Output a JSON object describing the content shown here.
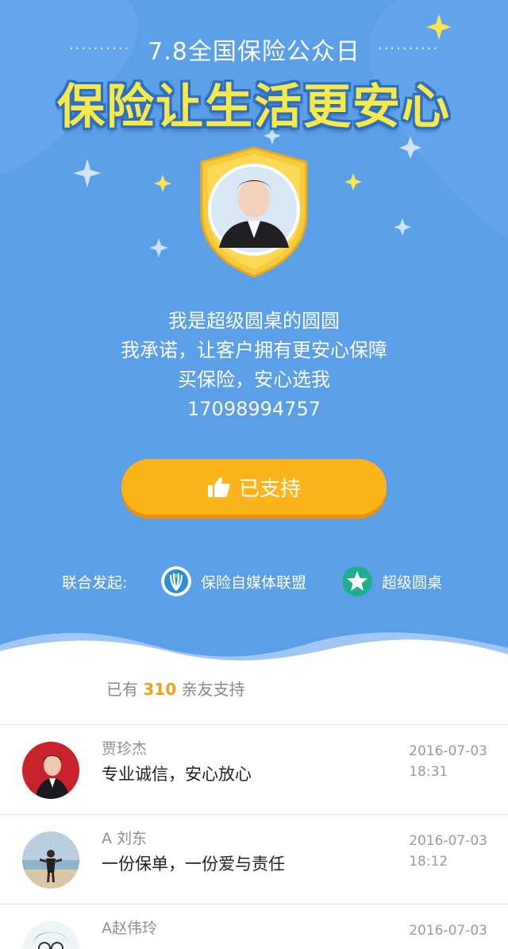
{
  "hero": {
    "subtitle": "7.8全国保险公众日",
    "dots_left": "··········",
    "dots_right": "··········",
    "title": "保险让生活更安心",
    "pledge_lines": [
      "我是超级圆桌的圆圆",
      "我承诺，让客户拥有更安心保障",
      "买保险，安心选我",
      "17098994757"
    ],
    "button_label": "已支持",
    "sponsors_label": "联合发起:",
    "sponsors": [
      {
        "name": "保险自媒体联盟",
        "icon": "alliance-logo-icon"
      },
      {
        "name": "超级圆桌",
        "icon": "star-logo-icon"
      }
    ]
  },
  "supporters": {
    "prefix": "已有",
    "count": "310",
    "suffix": "亲友支持",
    "rows": [
      {
        "name": "贾珍杰",
        "message": "专业诚信，安心放心",
        "date": "2016-07-03",
        "time": "18:31"
      },
      {
        "name": "A 刘东",
        "message": "一份保单，一份爱与责任",
        "date": "2016-07-03",
        "time": "18:12"
      },
      {
        "name": "A赵伟玲",
        "message": "",
        "date": "2016-07-03",
        "time": ""
      }
    ]
  },
  "colors": {
    "hero_bg": "#5a9ee9",
    "title_yellow": "#f7e94a",
    "button": "#fbb41a",
    "count_highlight": "#f0a310"
  }
}
